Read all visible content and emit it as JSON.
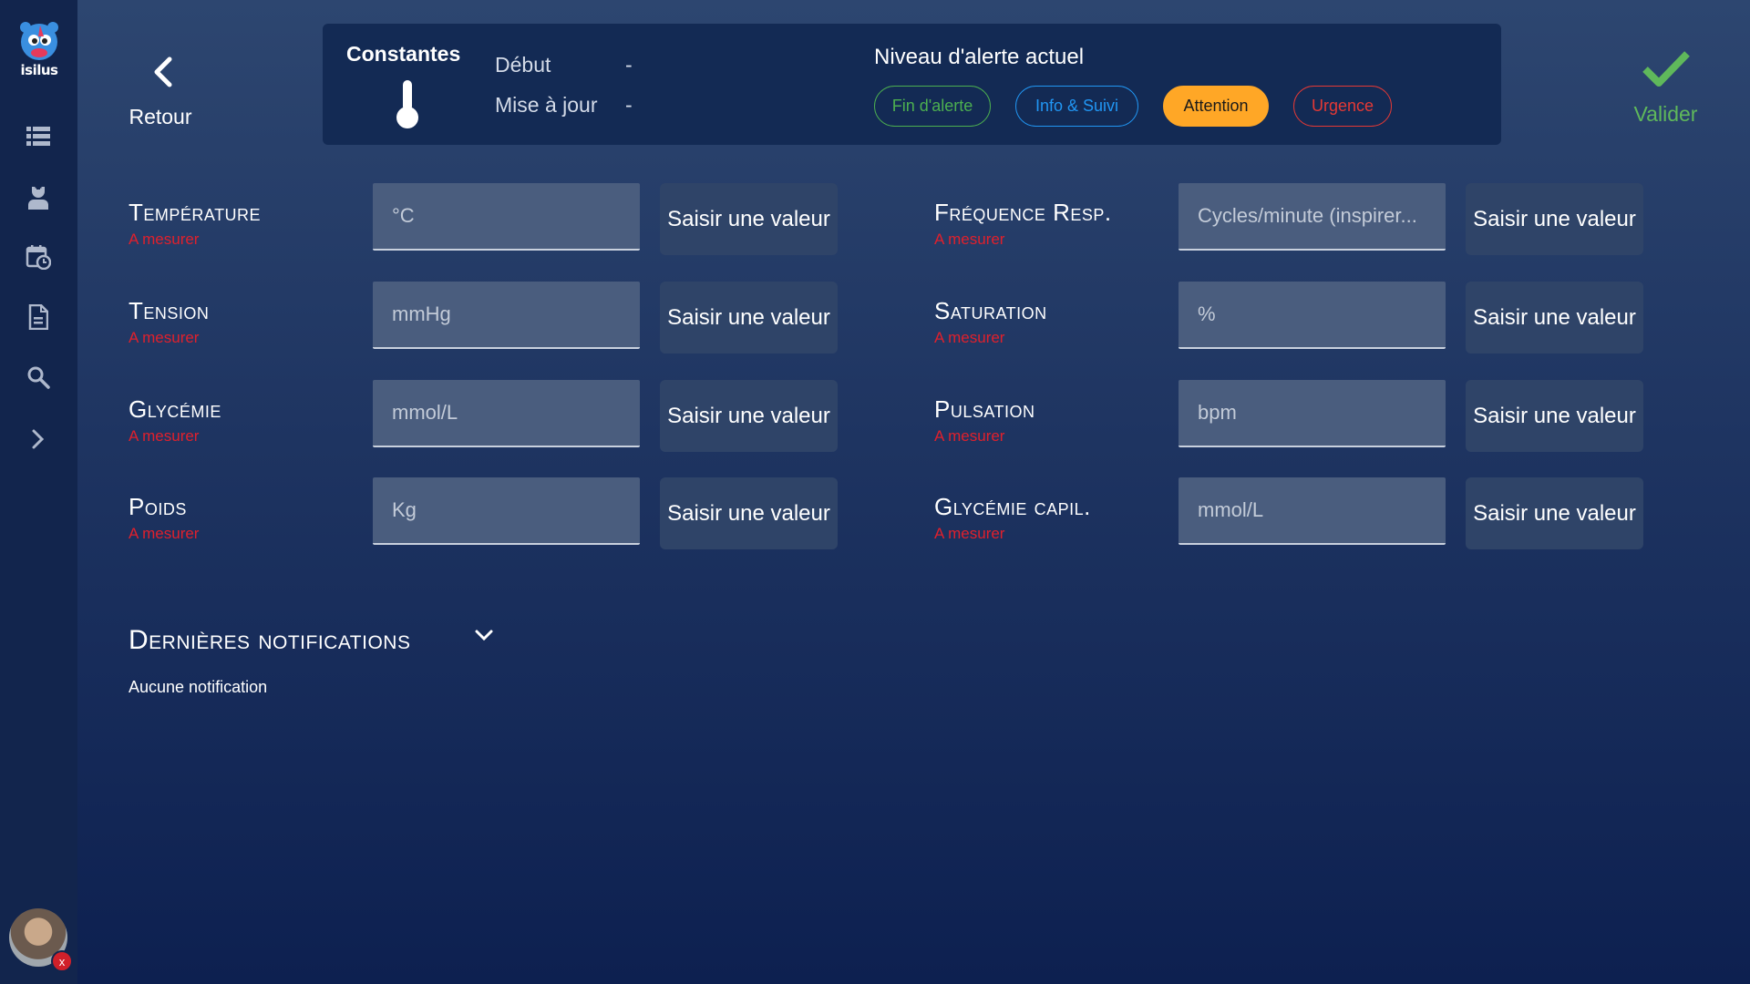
{
  "app": {
    "logo_text": "isilus"
  },
  "sidebar": {
    "items": [
      {
        "icon": "list-icon"
      },
      {
        "icon": "nurse-icon"
      },
      {
        "icon": "calendar-clock-icon"
      },
      {
        "icon": "document-icon"
      },
      {
        "icon": "search-icon"
      },
      {
        "icon": "chevron-right-icon"
      }
    ],
    "avatar_badge": "x"
  },
  "header": {
    "back_label": "Retour",
    "section_title": "Constantes",
    "start_label": "Début",
    "start_value": "-",
    "update_label": "Mise à jour",
    "update_value": "-",
    "alert_title": "Niveau d'alerte actuel",
    "alert_levels": [
      {
        "label": "Fin d'alerte",
        "color": "#4caf50",
        "selected": false
      },
      {
        "label": "Info & Suivi",
        "color": "#2196f3",
        "selected": false
      },
      {
        "label": "Attention",
        "color": "#ffa726",
        "selected": true
      },
      {
        "label": "Urgence",
        "color": "#e53935",
        "selected": false
      }
    ],
    "validate_label": "Valider"
  },
  "measures": {
    "button_label": "Saisir une valeur",
    "status": "A mesurer",
    "left": [
      {
        "name": "Température",
        "placeholder": "°C"
      },
      {
        "name": "Tension",
        "placeholder": "mmHg"
      },
      {
        "name": "Glycémie",
        "placeholder": "mmol/L"
      },
      {
        "name": "Poids",
        "placeholder": "Kg"
      }
    ],
    "right": [
      {
        "name": "Fréquence Resp.",
        "placeholder": "Cycles/minute (inspirer..."
      },
      {
        "name": "Saturation",
        "placeholder": "%"
      },
      {
        "name": "Pulsation",
        "placeholder": "bpm"
      },
      {
        "name": "Glycémie capil.",
        "placeholder": "mmol/L"
      }
    ]
  },
  "notifications": {
    "title": "Dernières notifications",
    "empty": "Aucune notification"
  },
  "colors": {
    "accent_green": "#5fb85b",
    "status_red": "#e0202c"
  }
}
